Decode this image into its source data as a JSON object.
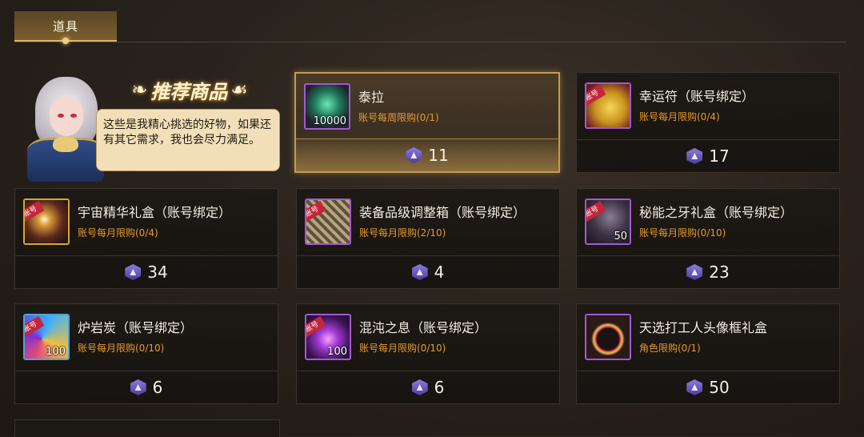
{
  "tab": {
    "label": "道具"
  },
  "recommend": {
    "title": "推荐商品",
    "dialogue": "这些是我精心挑选的好物，如果还有其它需求，我也会尽力满足。"
  },
  "items": [
    {
      "name": "泰拉",
      "limit": "账号每周限购(0/1)",
      "price": "11",
      "qty": "10000",
      "badge": "",
      "icon": "terra-crystal-icon"
    },
    {
      "name": "幸运符（账号绑定）",
      "limit": "账号每月限购(0/4)",
      "price": "17",
      "qty": "",
      "badge": "账号",
      "icon": "lucky-charm-icon"
    },
    {
      "name": "宇宙精华礼盒（账号绑定）",
      "limit": "账号每月限购(0/4)",
      "price": "34",
      "qty": "",
      "badge": "账号",
      "icon": "cosmic-essence-box-icon"
    },
    {
      "name": "装备品级调整箱（账号绑定）",
      "limit": "账号每月限购(2/10)",
      "price": "4",
      "qty": "",
      "badge": "账号",
      "icon": "equipment-grade-box-icon"
    },
    {
      "name": "秘能之牙礼盒（账号绑定）",
      "limit": "账号每月限购(0/10)",
      "price": "23",
      "qty": "50",
      "badge": "账号",
      "icon": "arcane-fang-box-icon"
    },
    {
      "name": "炉岩炭（账号绑定）",
      "limit": "账号每月限购(0/10)",
      "price": "6",
      "qty": "100",
      "badge": "账号",
      "icon": "furnace-coal-icon"
    },
    {
      "name": "混沌之息（账号绑定）",
      "limit": "账号每月限购(0/10)",
      "price": "6",
      "qty": "100",
      "badge": "账号",
      "icon": "chaos-breath-icon"
    },
    {
      "name": "天选打工人头像框礼盒",
      "limit": "角色限购(0/1)",
      "price": "50",
      "qty": "",
      "badge": "",
      "icon": "avatar-frame-box-icon"
    }
  ]
}
